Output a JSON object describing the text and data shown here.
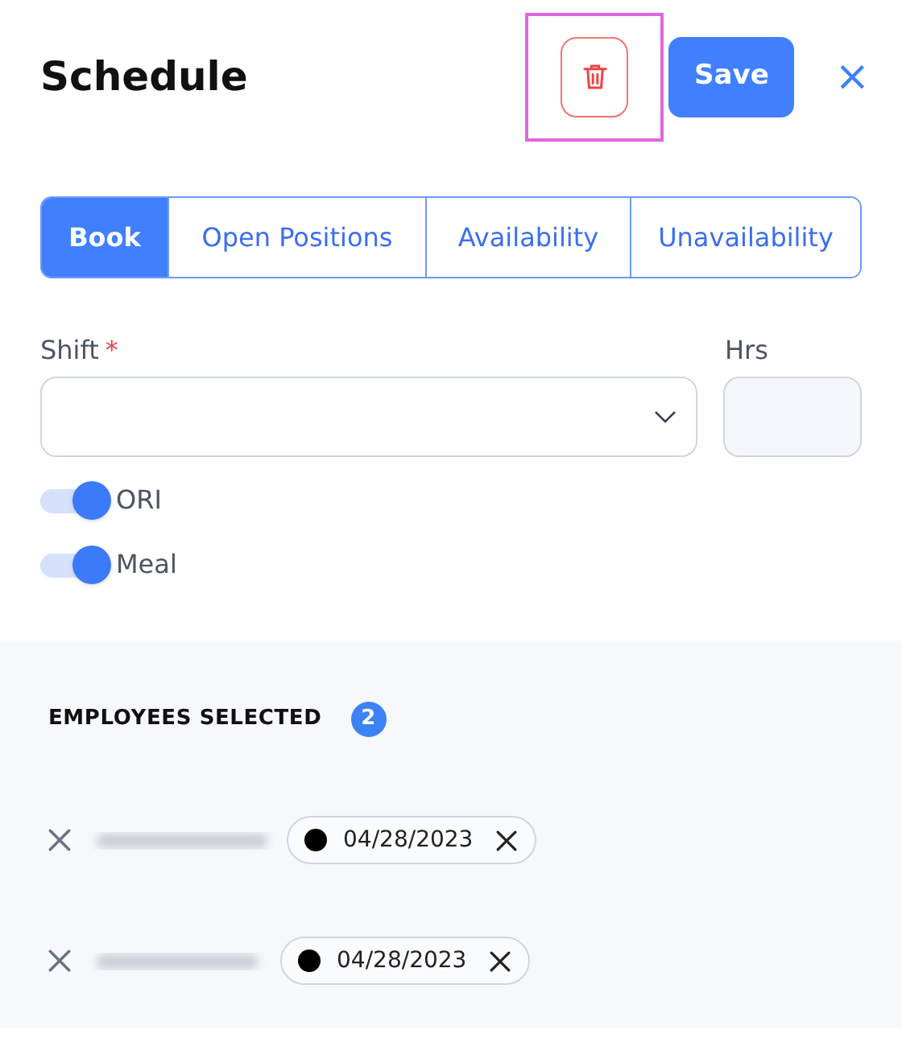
{
  "title": "Schedule",
  "header_buttons": {
    "delete_highlighted": true,
    "save": "Save",
    "close": "×"
  },
  "tabs": [
    {
      "label": "Book",
      "selected": true
    },
    {
      "label": "Open Positions",
      "selected": false
    },
    {
      "label": "Availability",
      "selected": false
    },
    {
      "label": "Unavailability",
      "selected": false
    }
  ],
  "shift": {
    "label": "Shift",
    "required_mark": "*"
  },
  "hrs": {
    "label": "Hrs"
  },
  "toggles": [
    {
      "label": "ORI",
      "on": true
    },
    {
      "label": "Meal",
      "on": true
    }
  ],
  "employees": {
    "heading": "EMPLOYEES SELECTED",
    "count": "2",
    "rows": [
      {
        "date": "04/28/2023"
      },
      {
        "date": "04/28/2023"
      }
    ]
  }
}
